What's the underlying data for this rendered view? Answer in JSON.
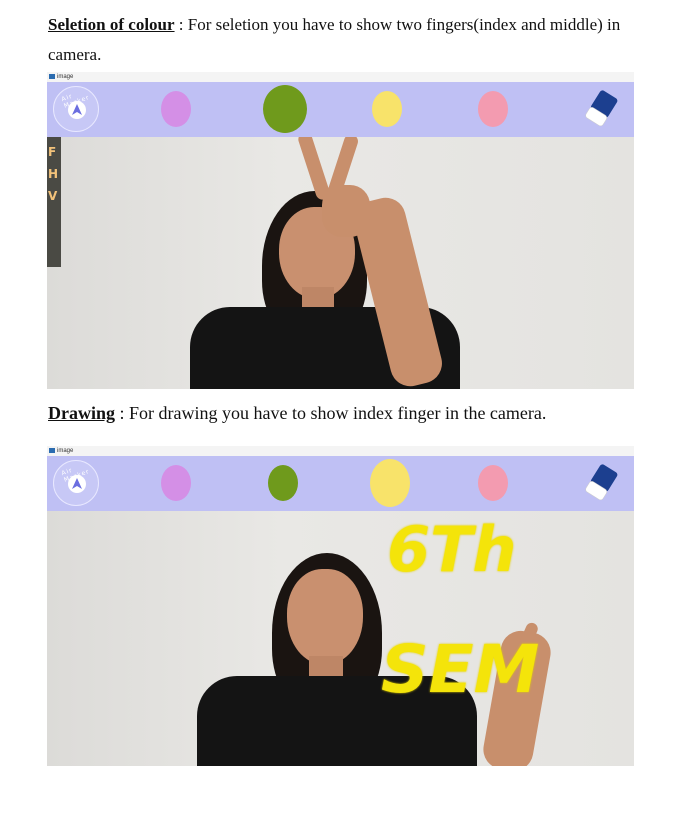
{
  "sections": [
    {
      "heading": "Seletion of colour",
      "text": " : For seletion you have to show two fingers(index and middle) in camera."
    },
    {
      "heading": "Drawing",
      "text": " : For drawing you have to show index finger in the camera."
    }
  ],
  "window": {
    "title": "image"
  },
  "palette": {
    "logo_text": "Air Marker",
    "colors": {
      "purple": "#d48fe6",
      "green": "#6f9a1c",
      "yellow": "#f8e36a",
      "pink": "#f39bb0",
      "eraser": "#1c3f8f",
      "bar": "#bfc0f4"
    }
  },
  "drawing": {
    "line1": "6Th",
    "line2": "SEM"
  }
}
